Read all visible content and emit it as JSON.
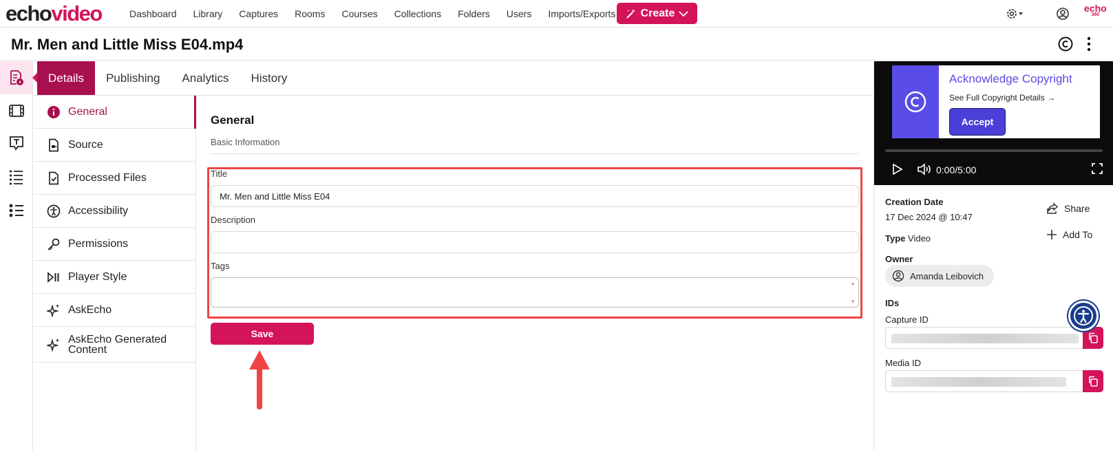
{
  "brand": {
    "logo_part1": "echo",
    "logo_part2": "video",
    "corner_logo_top": "echo",
    "corner_logo_bottom": "360",
    "accent": "#d4145a"
  },
  "nav": {
    "items": [
      "Dashboard",
      "Library",
      "Captures",
      "Rooms",
      "Courses",
      "Collections",
      "Folders",
      "Users",
      "Imports/Exports"
    ],
    "create_label": "Create"
  },
  "page": {
    "title": "Mr. Men and Little Miss E04.mp4"
  },
  "tabs": [
    {
      "label": "Details",
      "active": true
    },
    {
      "label": "Publishing",
      "active": false
    },
    {
      "label": "Analytics",
      "active": false
    },
    {
      "label": "History",
      "active": false
    }
  ],
  "sidenav": [
    {
      "label": "General",
      "icon": "info-icon",
      "active": true
    },
    {
      "label": "Source",
      "icon": "file-icon"
    },
    {
      "label": "Processed Files",
      "icon": "file-check-icon"
    },
    {
      "label": "Accessibility",
      "icon": "accessibility-icon"
    },
    {
      "label": "Permissions",
      "icon": "key-icon"
    },
    {
      "label": "Player Style",
      "icon": "play-pause-icon"
    },
    {
      "label": "AskEcho",
      "icon": "sparkle-icon"
    },
    {
      "label": "AskEcho Generated Content",
      "icon": "sparkle-icon"
    }
  ],
  "general": {
    "title": "General",
    "subtitle": "Basic Information",
    "title_label": "Title",
    "title_value": "Mr. Men and Little Miss E04",
    "description_label": "Description",
    "description_value": "",
    "tags_label": "Tags",
    "save_label": "Save"
  },
  "copyright": {
    "title": "Acknowledge Copyright",
    "link": "See Full Copyright Details",
    "accept_label": "Accept",
    "color": "#5a4ce6"
  },
  "player": {
    "time": "0:00/5:00"
  },
  "details": {
    "creation_label": "Creation Date",
    "creation_value": "17 Dec 2024 @ 10:47",
    "type_label": "Type",
    "type_value": "Video",
    "share_label": "Share",
    "add_to_label": "Add To",
    "owner_label": "Owner",
    "owner_name": "Amanda Leibovich",
    "ids_label": "IDs",
    "capture_id_label": "Capture ID",
    "media_id_label": "Media ID"
  }
}
